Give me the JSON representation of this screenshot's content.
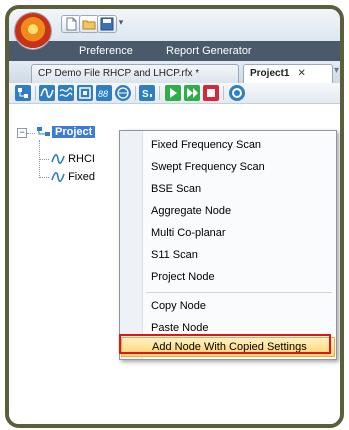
{
  "app": {
    "menubar": {
      "items": [
        "Preference",
        "Report Generator"
      ]
    },
    "quick_access": {
      "icons": [
        "new-file-icon",
        "open-folder-icon",
        "save-icon"
      ],
      "dropdown": "▾"
    }
  },
  "tabs": [
    {
      "label": "CP Demo File RHCP and LHCP.rfx *",
      "active": false
    },
    {
      "label": "Project1",
      "close": "✕",
      "active": true
    }
  ],
  "tab_overflow": "▾",
  "toolbar": {
    "icons": [
      "project-icon",
      "wave-icon",
      "multi-wave-icon",
      "bse-icon",
      "coplanar-icon",
      "s11-icon",
      "sweep-icon",
      "play-icon",
      "step-icon",
      "stop-icon",
      "record-icon"
    ]
  },
  "tree": {
    "root": {
      "label": "Project",
      "expander": "−"
    },
    "children": [
      {
        "label": "RHCI"
      },
      {
        "label": "Fixed"
      }
    ]
  },
  "context_menu": {
    "items": [
      "Fixed Frequency Scan",
      "Swept Frequency Scan",
      "BSE Scan",
      "Aggregate Node",
      "Multi Co-planar",
      "S11 Scan",
      "Project Node",
      "Copy Node",
      "Paste Node",
      "Add Node With Copied Settings"
    ],
    "highlighted_index": 9
  },
  "colors": {
    "menubar_bg": "#4a5a6b",
    "selection": "#3d7bd6",
    "highlight": "#ffd46b",
    "callout": "#e0141c",
    "frame": "#5a5e3a"
  }
}
